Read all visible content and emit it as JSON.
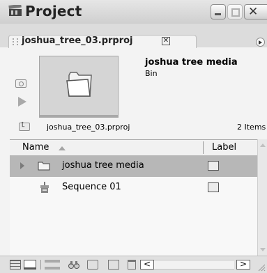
{
  "window": {
    "title": "Project",
    "app_icon": "film-slate-icon",
    "controls": [
      "minimize",
      "maximize",
      "close"
    ]
  },
  "tab": {
    "label": "joshua_tree_03.prproj",
    "close_glyph": "✕"
  },
  "preview": {
    "clip_name": "joshua tree media",
    "clip_type": "Bin",
    "thumbnail_icon": "folder-icon",
    "side_icons": [
      "camera-icon",
      "play-icon"
    ]
  },
  "info_row": {
    "project_name": "joshua_tree_03.prproj",
    "item_count": "2 Items"
  },
  "list": {
    "columns": [
      {
        "label": "Name",
        "sorted": "ascending"
      },
      {
        "label": "Label"
      }
    ],
    "rows": [
      {
        "name": "joshua tree media",
        "type_icon": "bin-folder-icon",
        "expandable": true,
        "selected": true,
        "label_color": "#ececec"
      },
      {
        "name": "Sequence 01",
        "type_icon": "sequence-icon",
        "expandable": false,
        "selected": false,
        "label_color": "#ececec"
      }
    ]
  },
  "bottom_toolbar": {
    "buttons": [
      "list-view",
      "icon-view",
      "automate-to-sequence",
      "find",
      "new-bin",
      "new-item",
      "clear",
      "scroll-left",
      "scroll-right"
    ],
    "scroll_left_glyph": "<",
    "scroll_right_glyph": ">"
  },
  "colors": {
    "selected_row": "#b7b7b7",
    "titlebar": "#d8d8d8",
    "panel_bg": "#f3f3f3"
  }
}
